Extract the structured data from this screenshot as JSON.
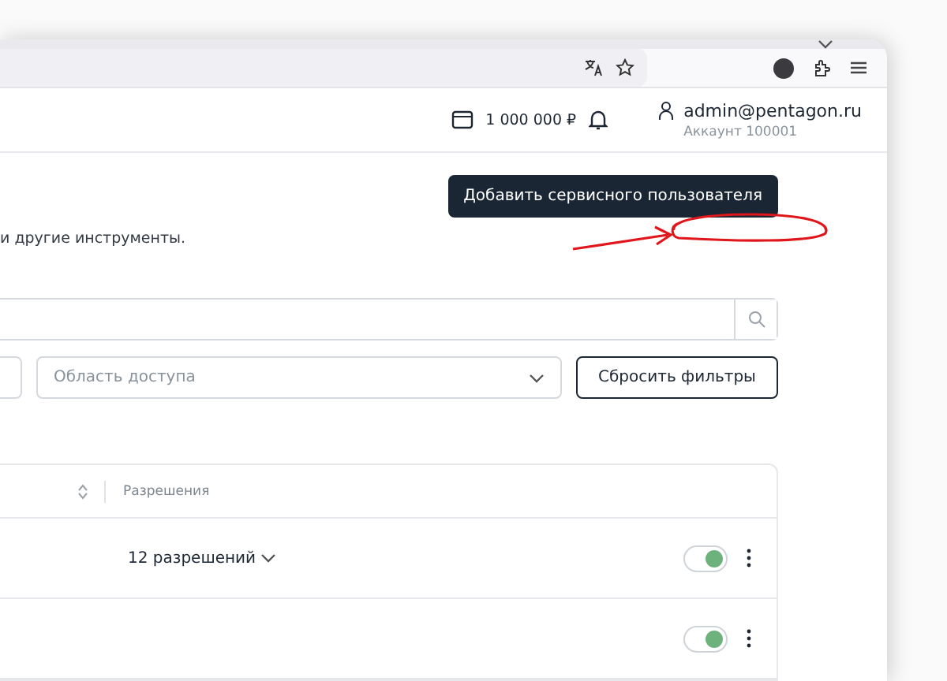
{
  "header": {
    "balance": "1 000 000 ₽",
    "user_email": "admin@pentagon.ru",
    "account": "Аккаунт 100001"
  },
  "add_button": "Добавить сервисного пользователя",
  "description": "и другие инструменты.",
  "filters": [
    {
      "placeholder": "Область доступа"
    }
  ],
  "reset_button": "Сбросить фильтры",
  "table": {
    "columns": [
      {
        "label": "Разрешения"
      }
    ],
    "rows": [
      {
        "permissions": "12 разрешений",
        "on": true
      },
      {
        "on": true
      }
    ]
  }
}
